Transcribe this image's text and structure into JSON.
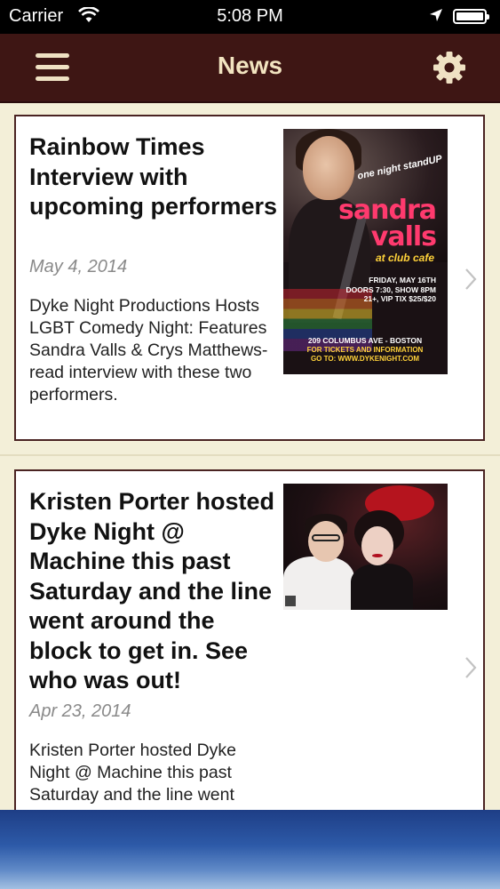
{
  "status_bar": {
    "carrier": "Carrier",
    "time": "5:08 PM",
    "icons": [
      "wifi-icon",
      "location-arrow-icon",
      "battery-icon"
    ]
  },
  "nav": {
    "title": "News",
    "menu_icon": "hamburger-menu-icon",
    "settings_icon": "gear-icon",
    "background_color": "#3e1614",
    "title_color": "#f2e4c0"
  },
  "articles": [
    {
      "title": "Rainbow Times Interview with upcoming performers",
      "date": "May 4, 2014",
      "summary": "Dyke Night Productions Hosts LGBT Comedy Night: Features Sandra Valls & Crys Matthews- read interview with these two performers.",
      "thumbnail": {
        "tagline": "one night standUP",
        "name_line1": "sandra",
        "name_line2": "valls",
        "venue": "at club cafe",
        "info_line1": "FRIDAY, MAY 16TH",
        "info_line2": "DOORS 7:30, SHOW 8PM",
        "info_line3": "21+, VIP TIX $25/$20",
        "address": "209 COLUMBUS AVE - BOSTON",
        "tickets": "FOR TICKETS AND INFORMATION",
        "url": "GO TO: WWW.DYKENIGHT.COM"
      }
    },
    {
      "title": "Kristen Porter hosted Dyke Night @ Machine this past Saturday and the line went around the block to get in. See who was out!",
      "date": "Apr 23, 2014",
      "summary": "Kristen Porter hosted Dyke Night @ Machine this past Saturday and the line went"
    }
  ],
  "colors": {
    "page_background": "#f3efd8",
    "card_border": "#4a2322",
    "date_color": "#8a8a8a"
  }
}
